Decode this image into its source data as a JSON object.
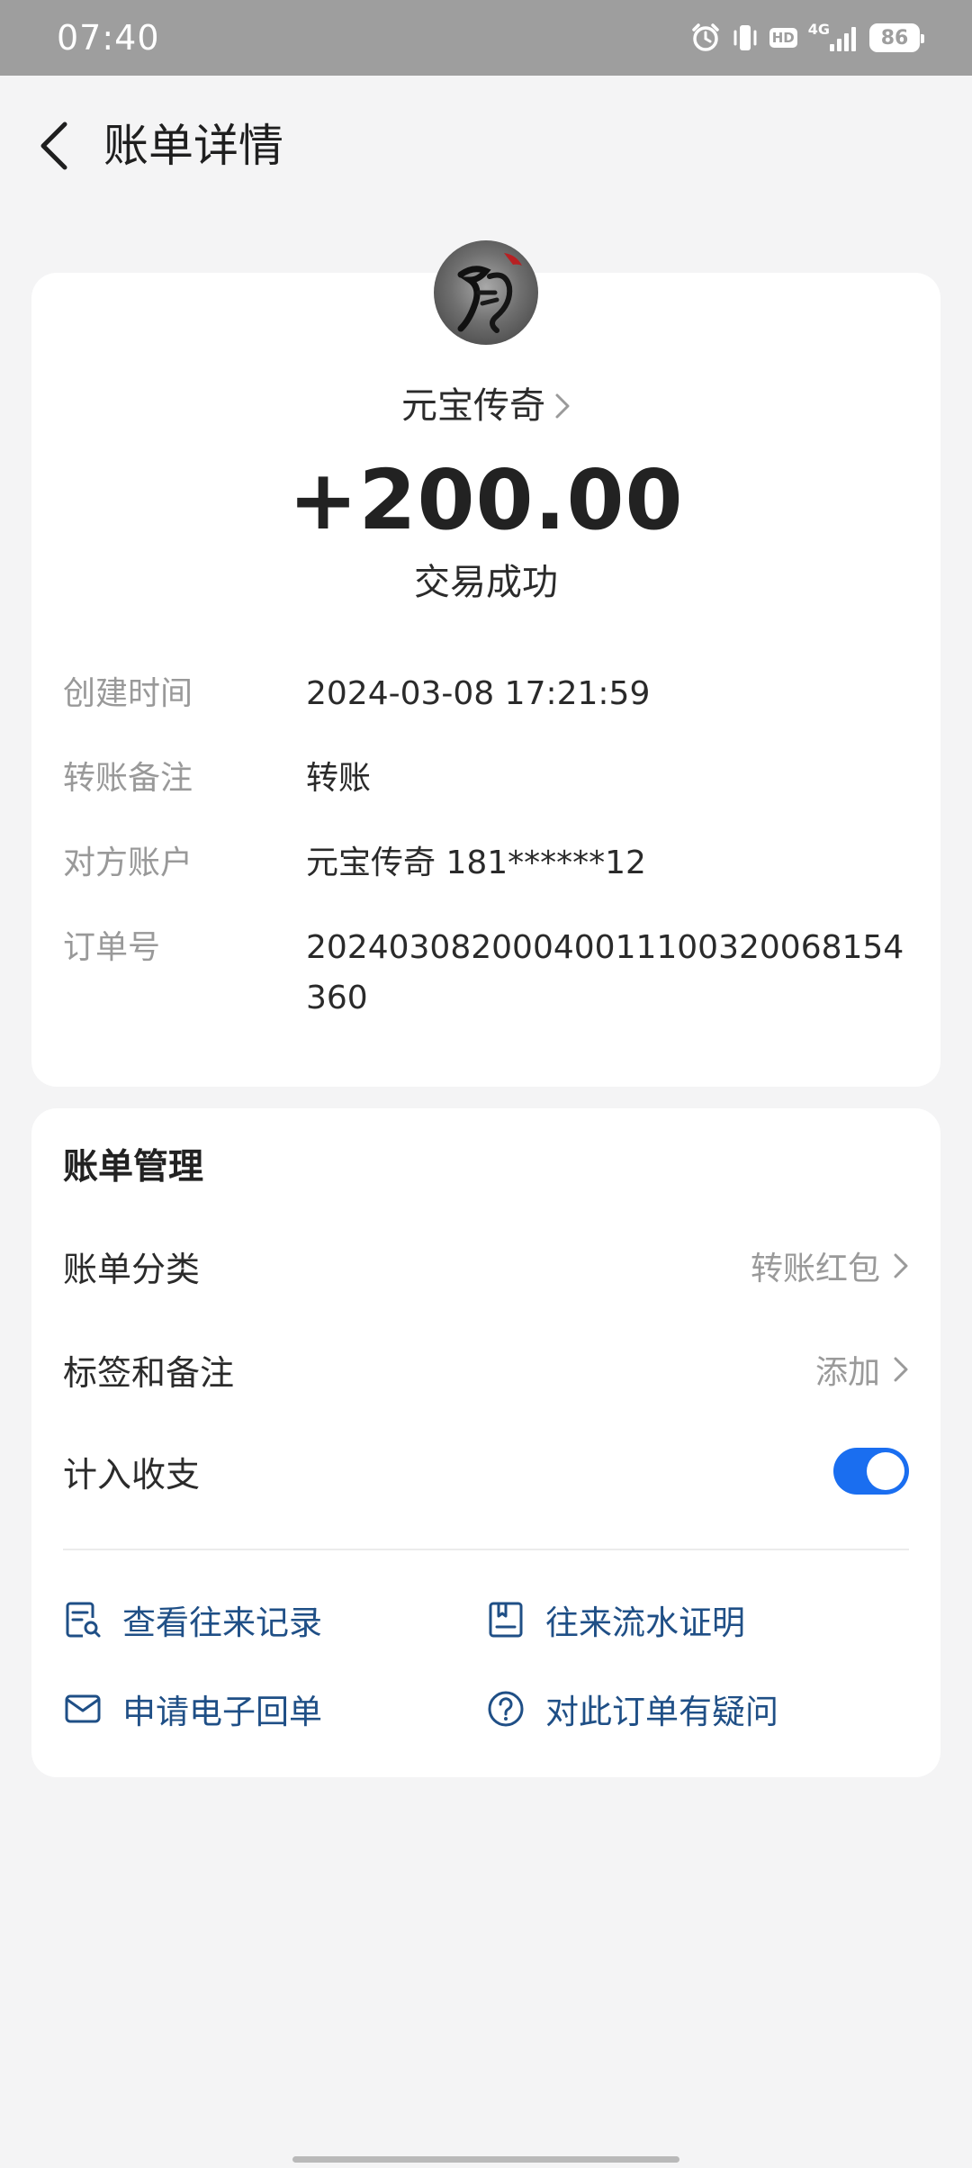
{
  "status_bar": {
    "time": "07:40",
    "icons": [
      "alarm-icon",
      "vibrate-icon",
      "hd-icon",
      "4g-signal-icon",
      "battery-icon"
    ],
    "hd_label": "HD",
    "network_label": "4G",
    "battery_level": "86"
  },
  "header": {
    "back_icon": "chevron-left-icon",
    "title": "账单详情"
  },
  "detail": {
    "merchant_name": "元宝传奇",
    "amount": "+200.00",
    "status": "交易成功",
    "fields": [
      {
        "label": "创建时间",
        "value": "2024-03-08 17:21:59"
      },
      {
        "label": "转账备注",
        "value": "转账"
      },
      {
        "label": "对方账户",
        "value": "元宝传奇 181******12"
      },
      {
        "label": "订单号",
        "value": "20240308200040011100320068154360"
      }
    ]
  },
  "management": {
    "title": "账单管理",
    "category_label": "账单分类",
    "category_value": "转账红包",
    "tags_label": "标签和备注",
    "tags_value": "添加",
    "include_label": "计入收支",
    "include_enabled": true,
    "links": [
      {
        "label": "查看往来记录",
        "icon": "record-search-icon"
      },
      {
        "label": "往来流水证明",
        "icon": "document-icon"
      },
      {
        "label": "申请电子回单",
        "icon": "mail-icon"
      },
      {
        "label": "对此订单有疑问",
        "icon": "question-icon"
      }
    ]
  },
  "colors": {
    "accent": "#1a6ef0",
    "link": "#1f4f86",
    "background": "#f4f4f5"
  }
}
